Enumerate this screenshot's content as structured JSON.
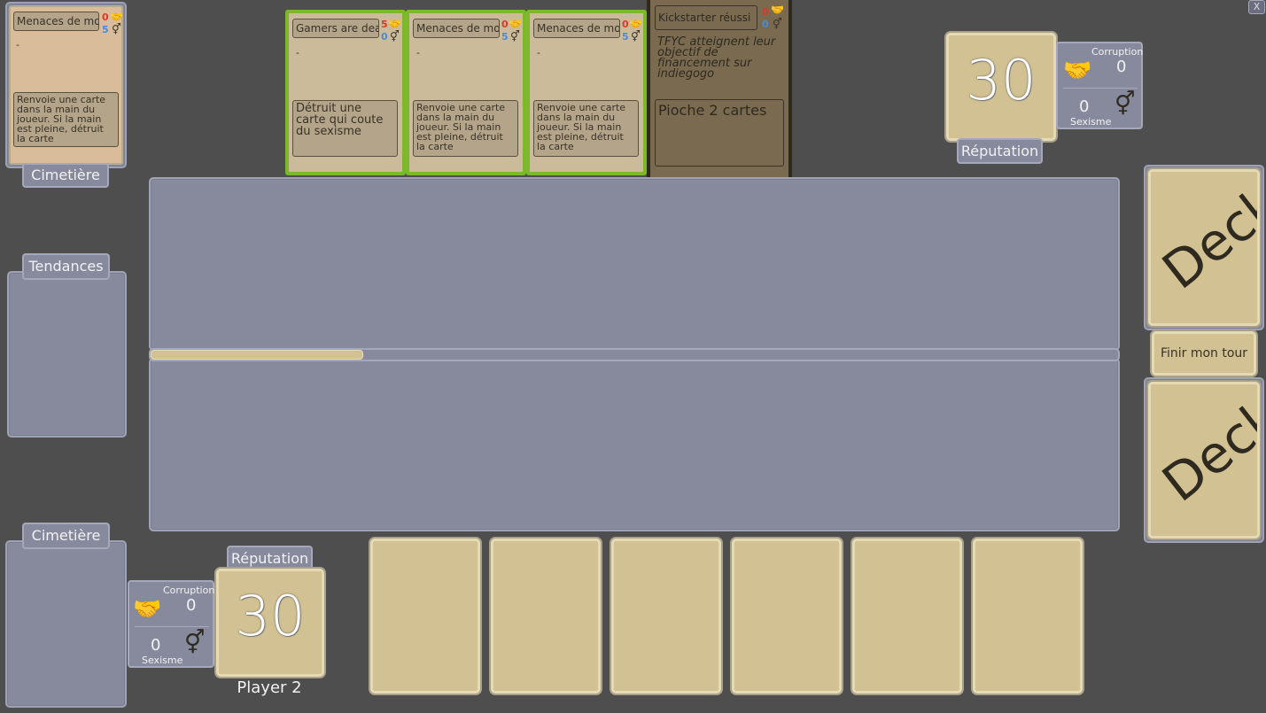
{
  "close_button": "X",
  "graveyards": {
    "top_label": "Cimetière",
    "bottom_label": "Cimetière"
  },
  "trends_label": "Tendances",
  "graveyard_card": {
    "title": "Menaces de mort",
    "red": "0",
    "blue": "5",
    "dash": "-",
    "text": "Renvoie une carte dans la main du joueur. Si la main est pleine, détruit la carte"
  },
  "opponent_cards": [
    {
      "title": "Gamers are dead",
      "red": "5",
      "blue": "0",
      "dash": "-",
      "text": "Détruit une carte qui coute du sexisme"
    },
    {
      "title": "Menaces de mort",
      "red": "0",
      "blue": "5",
      "dash": "-",
      "text": "Renvoie une carte dans la main du joueur. Si la main est pleine, détruit la carte"
    },
    {
      "title": "Menaces de mort",
      "red": "0",
      "blue": "5",
      "dash": "-",
      "text": "Renvoie une carte dans la main du joueur. Si la main est pleine, détruit la carte"
    }
  ],
  "event_card": {
    "title": "Kickstarter réussi",
    "red": "0",
    "blue": "0",
    "flavor": "TFYC atteignent leur objectif de financement sur indiegogo",
    "text": "Pioche 2 cartes"
  },
  "opponent": {
    "reputation": "30",
    "reputation_label": "Réputation",
    "corruption_label": "Corruption",
    "corruption": "0",
    "sexism": "0",
    "sexism_label": "Sexisme"
  },
  "player": {
    "reputation": "30",
    "reputation_label": "Réputation",
    "name": "Player 2",
    "corruption_label": "Corruption",
    "corruption": "0",
    "sexism": "0",
    "sexism_label": "Sexisme"
  },
  "decks": {
    "top_label": "Deck",
    "bottom_label": "Deck"
  },
  "end_turn_button": "Finir mon tour",
  "timer": {
    "progress": 0.22
  },
  "hand_slots": 6,
  "icons": {
    "corruption": "handshake-icon",
    "sexism": "gender-symbol-icon"
  },
  "colors": {
    "background": "#4e4e4e",
    "panel": "#868a9c",
    "parchment": "#d2c192",
    "card": "#d9bd9a",
    "card_border_active": "#7cb829",
    "stat_red": "#d83a2a",
    "stat_blue": "#4a8ad8"
  }
}
